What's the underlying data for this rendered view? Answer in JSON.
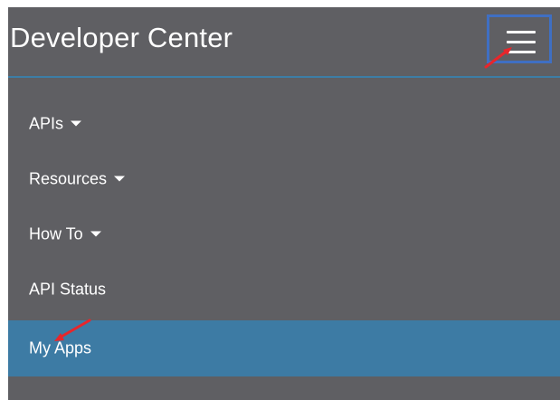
{
  "header": {
    "title": "Developer Center",
    "menu_toggle_icon": "hamburger-menu-icon"
  },
  "menu": {
    "items": [
      {
        "label": "APIs",
        "has_dropdown": true
      },
      {
        "label": "Resources",
        "has_dropdown": true
      },
      {
        "label": "How To",
        "has_dropdown": true
      },
      {
        "label": "API Status",
        "has_dropdown": false
      },
      {
        "label": "My Apps",
        "has_dropdown": false,
        "active": true
      }
    ]
  },
  "colors": {
    "background": "#5f5f63",
    "active_item": "#3d7ba4",
    "highlight_box": "#3f6fc3",
    "annotation_arrow": "#e8262b"
  }
}
